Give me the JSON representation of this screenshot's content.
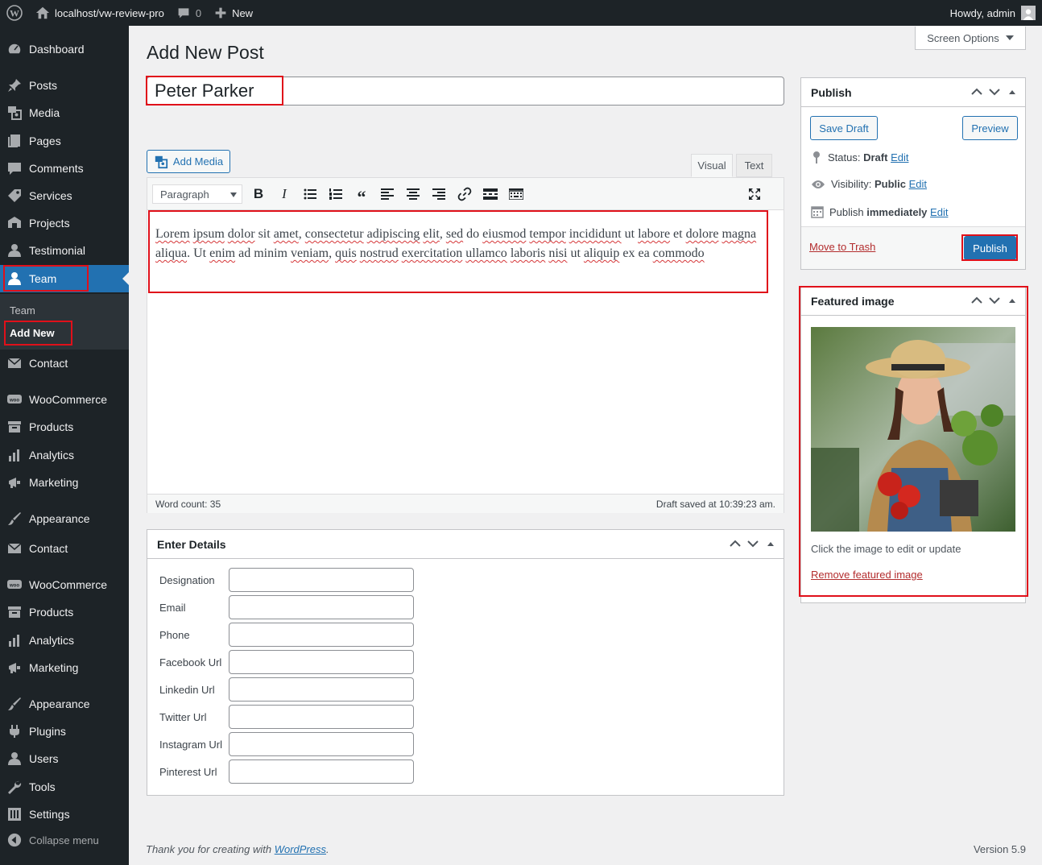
{
  "adminbar": {
    "site_url": "localhost/vw-review-pro",
    "comments_count": "0",
    "new_label": "New",
    "howdy": "Howdy, admin"
  },
  "menu": {
    "items": [
      {
        "label": "Dashboard",
        "icon": "dashboard-icon"
      },
      {
        "label": "Posts",
        "icon": "pin-icon"
      },
      {
        "label": "Media",
        "icon": "media-icon"
      },
      {
        "label": "Pages",
        "icon": "pages-icon"
      },
      {
        "label": "Comments",
        "icon": "comment-icon"
      },
      {
        "label": "Services",
        "icon": "tag-icon"
      },
      {
        "label": "Projects",
        "icon": "portfolio-icon"
      },
      {
        "label": "Testimonial",
        "icon": "user-icon"
      },
      {
        "label": "Team",
        "icon": "user-icon"
      },
      {
        "label": "Contact",
        "icon": "email-icon"
      },
      {
        "label": "WooCommerce",
        "icon": "woo-icon"
      },
      {
        "label": "Products",
        "icon": "archive-icon"
      },
      {
        "label": "Analytics",
        "icon": "chart-icon"
      },
      {
        "label": "Marketing",
        "icon": "megaphone-icon"
      },
      {
        "label": "Appearance",
        "icon": "brush-icon"
      },
      {
        "label": "Contact",
        "icon": "email-icon"
      },
      {
        "label": "WooCommerce",
        "icon": "woo-icon"
      },
      {
        "label": "Products",
        "icon": "archive-icon"
      },
      {
        "label": "Analytics",
        "icon": "chart-icon"
      },
      {
        "label": "Marketing",
        "icon": "megaphone-icon"
      },
      {
        "label": "Appearance",
        "icon": "brush-icon"
      },
      {
        "label": "Plugins",
        "icon": "plugin-icon"
      },
      {
        "label": "Users",
        "icon": "user-icon"
      },
      {
        "label": "Tools",
        "icon": "wrench-icon"
      },
      {
        "label": "Settings",
        "icon": "settings-icon"
      }
    ],
    "submenu": {
      "team": "Team",
      "add_new": "Add New"
    },
    "collapse": "Collapse menu"
  },
  "screen_options": "Screen Options",
  "page_title": "Add New Post",
  "post_title": "Peter Parker",
  "add_media": "Add Media",
  "tabs": {
    "visual": "Visual",
    "text": "Text"
  },
  "toolbar": {
    "format": "Paragraph"
  },
  "editor": {
    "content": "Lorem ipsum dolor sit amet, consectetur adipiscing elit, sed do eiusmod tempor incididunt ut labore et dolore magna aliqua. Ut enim ad minim veniam, quis nostrud exercitation ullamco laboris nisi ut aliquip ex ea commodo",
    "word_count": "Word count: 35",
    "draft_saved": "Draft saved at 10:39:23 am."
  },
  "details": {
    "title": "Enter Details",
    "fields": [
      "Designation",
      "Email",
      "Phone",
      "Facebook Url",
      "Linkedin Url",
      "Twitter Url",
      "Instagram Url",
      "Pinterest Url"
    ]
  },
  "publish": {
    "title": "Publish",
    "save_draft": "Save Draft",
    "preview": "Preview",
    "status_label": "Status:",
    "status_value": "Draft",
    "visibility_label": "Visibility:",
    "visibility_value": "Public",
    "schedule_label": "Publish",
    "schedule_value": "immediately",
    "edit": "Edit",
    "trash": "Move to Trash",
    "publish_btn": "Publish"
  },
  "featured": {
    "title": "Featured image",
    "hint": "Click the image to edit or update",
    "remove": "Remove featured image"
  },
  "footer": {
    "thanks_prefix": "Thank you for creating with ",
    "thanks_link": "WordPress",
    "thanks_suffix": ".",
    "version": "Version 5.9"
  },
  "colors": {
    "accent": "#2271b1",
    "highlight": "#e0101a",
    "sidebar": "#1d2327"
  }
}
